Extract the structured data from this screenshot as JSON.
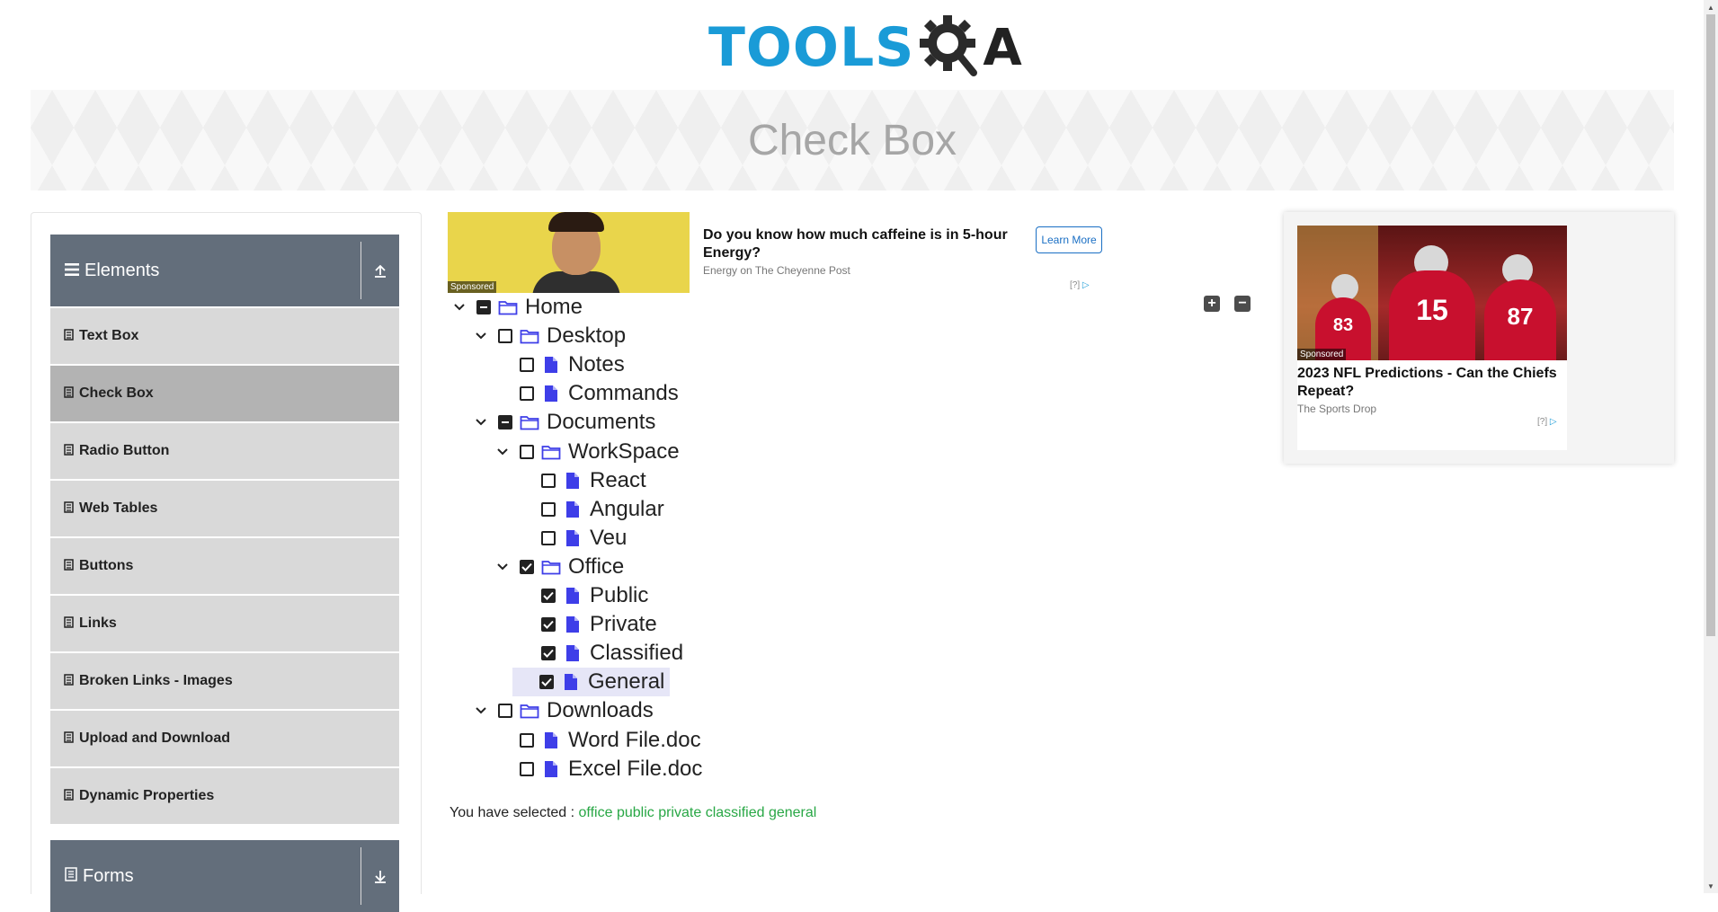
{
  "header": {
    "logo_text": "TOOLS",
    "logo_q": "Q",
    "logo_a": "A"
  },
  "banner": {
    "title": "Check Box"
  },
  "sidebar": {
    "groups": [
      {
        "label": "Elements",
        "icon": "menu-icon",
        "toggle_icon": "collapse-up-icon"
      },
      {
        "label": "Forms",
        "icon": "form-icon",
        "toggle_icon": "expand-down-icon"
      }
    ],
    "items": [
      {
        "label": "Text Box"
      },
      {
        "label": "Check Box",
        "active": true
      },
      {
        "label": "Radio Button"
      },
      {
        "label": "Web Tables"
      },
      {
        "label": "Buttons"
      },
      {
        "label": "Links"
      },
      {
        "label": "Broken Links - Images"
      },
      {
        "label": "Upload and Download"
      },
      {
        "label": "Dynamic Properties"
      }
    ]
  },
  "ad_top": {
    "badge": "Sponsored",
    "title": "Do you know how much caffeine is in 5-hour Energy?",
    "source": "Energy on The Cheyenne Post",
    "button": "Learn More",
    "choice": "[?]"
  },
  "tree": {
    "expand_all_icon": "plus-icon",
    "collapse_all_icon": "minus-icon",
    "nodes": [
      {
        "label": "Home",
        "type": "folder",
        "state": "half",
        "expanded": true
      },
      {
        "label": "Desktop",
        "type": "folder",
        "state": "unchecked",
        "expanded": true
      },
      {
        "label": "Notes",
        "type": "file",
        "state": "unchecked"
      },
      {
        "label": "Commands",
        "type": "file",
        "state": "unchecked"
      },
      {
        "label": "Documents",
        "type": "folder",
        "state": "half",
        "expanded": true
      },
      {
        "label": "WorkSpace",
        "type": "folder",
        "state": "unchecked",
        "expanded": true
      },
      {
        "label": "React",
        "type": "file",
        "state": "unchecked"
      },
      {
        "label": "Angular",
        "type": "file",
        "state": "unchecked"
      },
      {
        "label": "Veu",
        "type": "file",
        "state": "unchecked"
      },
      {
        "label": "Office",
        "type": "folder",
        "state": "checked",
        "expanded": true
      },
      {
        "label": "Public",
        "type": "file",
        "state": "checked"
      },
      {
        "label": "Private",
        "type": "file",
        "state": "checked"
      },
      {
        "label": "Classified",
        "type": "file",
        "state": "checked"
      },
      {
        "label": "General",
        "type": "file",
        "state": "checked",
        "highlighted": true
      },
      {
        "label": "Downloads",
        "type": "folder",
        "state": "unchecked",
        "expanded": true
      },
      {
        "label": "Word File.doc",
        "type": "file",
        "state": "unchecked"
      },
      {
        "label": "Excel File.doc",
        "type": "file",
        "state": "unchecked"
      }
    ]
  },
  "result": {
    "prefix": "You have selected :",
    "selected": [
      "office",
      "public",
      "private",
      "classified",
      "general"
    ]
  },
  "ad_right": {
    "badge": "Sponsored",
    "title": "2023 NFL Predictions - Can the Chiefs Repeat?",
    "source": "The Sports Drop",
    "choice": "[?]",
    "jersey_numbers": [
      "83",
      "15",
      "87"
    ]
  },
  "colors": {
    "accent": "#1a9bd7",
    "sidebar_header": "#636e7b",
    "menu_item": "#d9d9d9",
    "menu_item_active": "#b3b3b3",
    "icon_blue": "#3e3ee8",
    "selected_text": "#28a745"
  }
}
